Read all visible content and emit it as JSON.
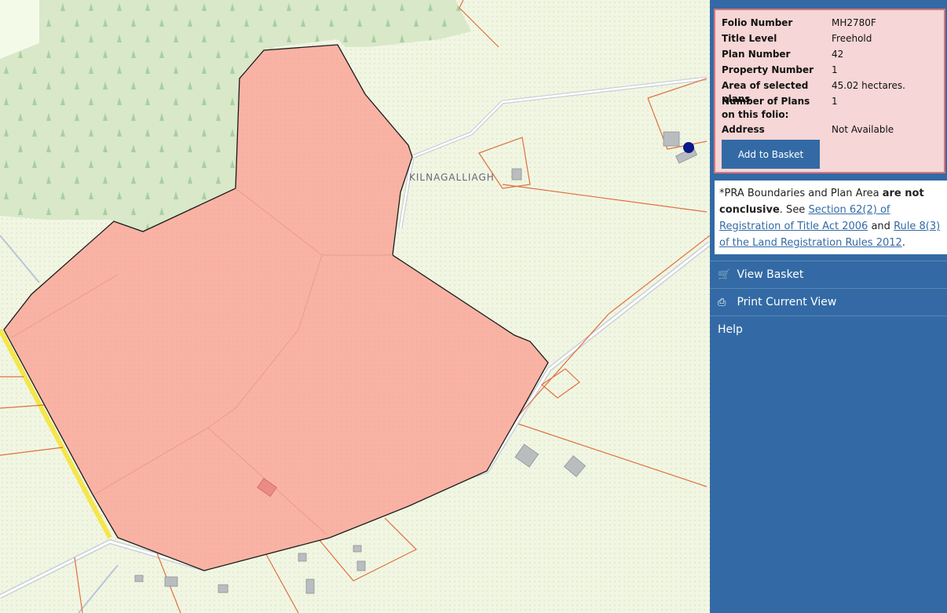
{
  "map": {
    "place_label": "KILNAGALLIAGH"
  },
  "info": {
    "rows": [
      {
        "label": "Folio Number",
        "value": "MH2780F"
      },
      {
        "label": "Title Level",
        "value": "Freehold"
      },
      {
        "label": "Plan Number",
        "value": "42"
      },
      {
        "label": "Property Number",
        "value": "1"
      },
      {
        "label": "Area of selected plans",
        "value": "45.02 hectares."
      },
      {
        "label": "Number of Plans on this folio:",
        "value": "1"
      },
      {
        "label": "Address",
        "value": "Not Available"
      }
    ],
    "add_button": "Add to Basket"
  },
  "disclaimer": {
    "prefix": "*PRA Boundaries and Plan Area",
    "bold": "are not conclusive",
    "see": ". See",
    "link1": "Section 62(2) of Registration of Title Act 2006",
    "and": "and",
    "link2": "Rule 8(3) of the Land Registration Rules 2012",
    "end": "."
  },
  "menu": {
    "view_basket": "View Basket",
    "view_basket_icon": "cart-icon",
    "print_view": "Print Current View",
    "print_view_icon": "printer-icon",
    "help": "Help"
  },
  "colors": {
    "sidebar": "#336aa5",
    "parcel_fill": "#f9b3a4",
    "card_bg": "#f6d6d6",
    "card_border": "#d9757a"
  }
}
